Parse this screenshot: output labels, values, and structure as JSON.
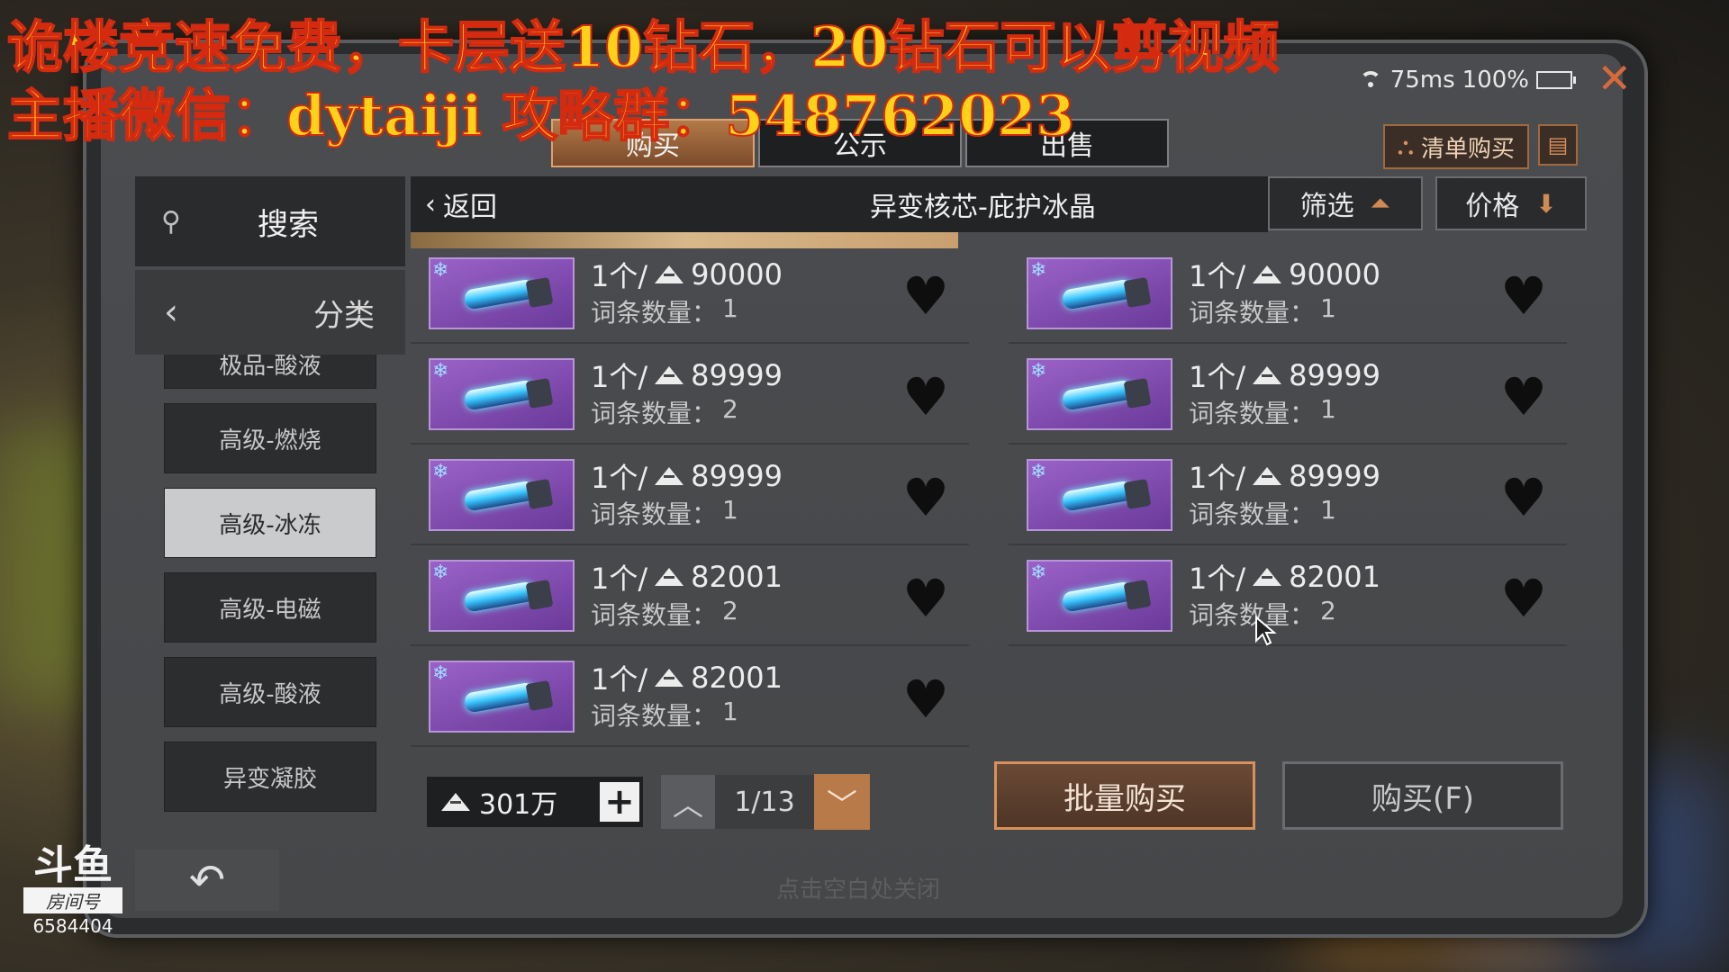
{
  "stream_overlay": {
    "line1": "诡楼竞速免费，卡层送10钻石，20钻石可以剪视频",
    "line2": "主播微信：dytaiji   攻略群：548762023"
  },
  "status_bar": {
    "ping": "75ms",
    "battery": "100%"
  },
  "tabs": [
    {
      "label": "购买",
      "active": true
    },
    {
      "label": "公示",
      "active": false
    },
    {
      "label": "出售",
      "active": false
    }
  ],
  "top_right": {
    "list_buy_label": "清单购买"
  },
  "sidebar": {
    "search_label": "搜索",
    "category_label": "分类",
    "items": [
      {
        "label": "极品-酸液",
        "selected": false
      },
      {
        "label": "高级-燃烧",
        "selected": false
      },
      {
        "label": "高级-冰冻",
        "selected": true
      },
      {
        "label": "高级-电磁",
        "selected": false
      },
      {
        "label": "高级-酸液",
        "selected": false
      },
      {
        "label": "异变凝胶",
        "selected": false
      }
    ]
  },
  "header": {
    "back_label": "返回",
    "title": "异变核芯-庇护冰晶",
    "filter_label": "筛选",
    "price_label": "价格"
  },
  "listings": [
    {
      "qty": "1个/",
      "price": "90000",
      "count_label": "词条数量：",
      "count": "1"
    },
    {
      "qty": "1个/",
      "price": "90000",
      "count_label": "词条数量：",
      "count": "1"
    },
    {
      "qty": "1个/",
      "price": "89999",
      "count_label": "词条数量：",
      "count": "2"
    },
    {
      "qty": "1个/",
      "price": "89999",
      "count_label": "词条数量：",
      "count": "1"
    },
    {
      "qty": "1个/",
      "price": "89999",
      "count_label": "词条数量：",
      "count": "1"
    },
    {
      "qty": "1个/",
      "price": "89999",
      "count_label": "词条数量：",
      "count": "1"
    },
    {
      "qty": "1个/",
      "price": "82001",
      "count_label": "词条数量：",
      "count": "2"
    },
    {
      "qty": "1个/",
      "price": "82001",
      "count_label": "词条数量：",
      "count": "2"
    },
    {
      "qty": "1个/",
      "price": "82001",
      "count_label": "词条数量：",
      "count": "1"
    }
  ],
  "footer": {
    "balance": "301万",
    "page": "1/13",
    "bulk_buy_label": "批量购买",
    "buy_label": "购买(F)",
    "close_hint": "点击空白处关闭"
  },
  "watermark": {
    "logo_text": "斗鱼",
    "sub_text": "房间号",
    "room_id": "6584404"
  },
  "colors": {
    "accent": "#d9905a",
    "tab_active": "#b27a48",
    "item_purple": "#8a52bc",
    "overlay_text": "#ffd21a",
    "overlay_stroke": "#d42a10"
  }
}
